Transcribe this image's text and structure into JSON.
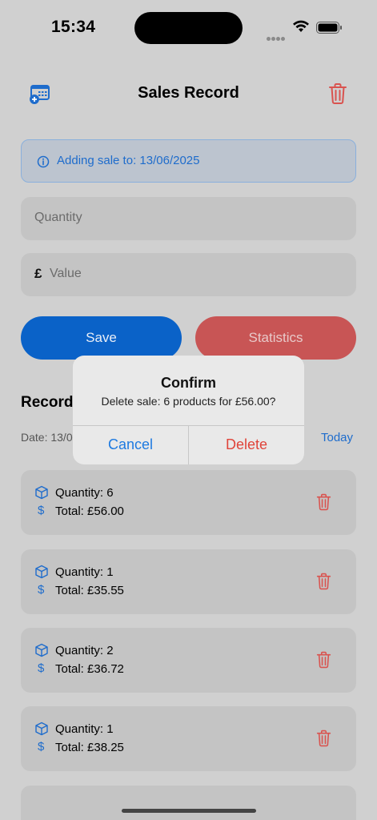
{
  "status_bar": {
    "time": "15:34"
  },
  "nav": {
    "title": "Sales Record",
    "left_icon": "calendar-add-icon",
    "right_icon": "trash-icon"
  },
  "banner": {
    "text": "Adding sale to: 13/06/2025",
    "icon": "info-icon"
  },
  "form": {
    "quantity_placeholder": "Quantity",
    "currency_symbol": "£",
    "value_placeholder": "Value",
    "save_label": "Save",
    "statistics_label": "Statistics"
  },
  "records": {
    "title": "Record",
    "date_label": "Date: 13/0",
    "today_label": "Today",
    "items": [
      {
        "quantity": "Quantity: 6",
        "total": "Total: £56.00"
      },
      {
        "quantity": "Quantity: 1",
        "total": "Total: £35.55"
      },
      {
        "quantity": "Quantity: 2",
        "total": "Total: £36.72"
      },
      {
        "quantity": "Quantity: 1",
        "total": "Total: £38.25"
      }
    ],
    "dollar_symbol": "$"
  },
  "alert": {
    "title": "Confirm",
    "message": "Delete sale: 6 products for £56.00?",
    "cancel_label": "Cancel",
    "delete_label": "Delete"
  },
  "colors": {
    "accent": "#1e6ccc",
    "destructive": "#e0443a",
    "dim_background": "#d0d0d0"
  }
}
